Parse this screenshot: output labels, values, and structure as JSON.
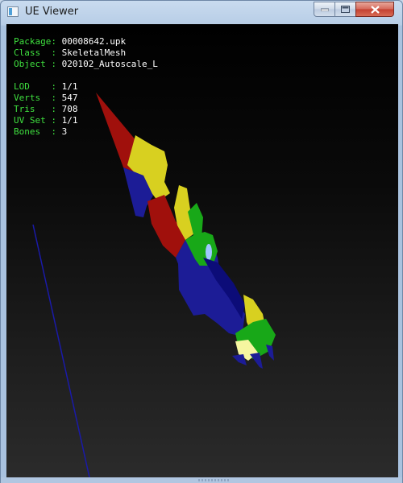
{
  "window": {
    "title": "UE Viewer",
    "icon": "app-window-icon",
    "controls": [
      "minimize-icon",
      "maximize-icon",
      "close-icon"
    ]
  },
  "info": {
    "package": {
      "key": "Package",
      "sep": ": ",
      "value": "00008642.upk"
    },
    "class": {
      "key": "Class  ",
      "sep": ": ",
      "value": "SkeletalMesh"
    },
    "object": {
      "key": "Object ",
      "sep": ": ",
      "value": "020102_Autoscale_L"
    },
    "lod": {
      "key": "LOD    ",
      "sep": ": ",
      "value": "1/1"
    },
    "verts": {
      "key": "Verts  ",
      "sep": ": ",
      "value": "547"
    },
    "tris": {
      "key": "Tris   ",
      "sep": ": ",
      "value": "708"
    },
    "uvset": {
      "key": "UV Set ",
      "sep": ": ",
      "value": "1/1"
    },
    "bones": {
      "key": "Bones  ",
      "sep": ": ",
      "value": "3"
    }
  },
  "colors": {
    "label": "#3fe03f",
    "value": "#ffffff",
    "mesh_red": "#a0100c",
    "mesh_yellow": "#d8d020",
    "mesh_blue": "#1c1c96",
    "mesh_green": "#18a818",
    "axis": "#1a1aa8"
  }
}
